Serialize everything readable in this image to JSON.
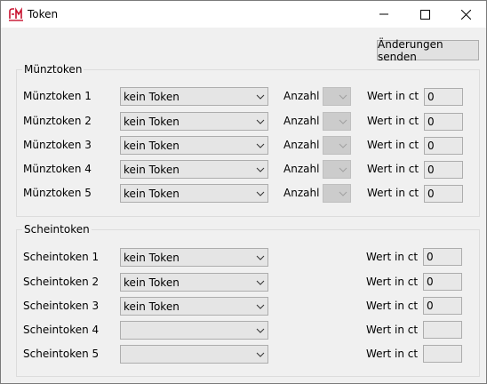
{
  "window": {
    "title": "Token",
    "icon": "app-logo-icon",
    "controls": [
      "minimize-icon",
      "maximize-icon",
      "close-icon"
    ]
  },
  "send_button": {
    "label": "Änderungen senden"
  },
  "coin_group": {
    "title": "Münztoken",
    "count_label": "Anzahl",
    "value_label": "Wert in ct",
    "rows": [
      {
        "label": "Münztoken 1",
        "token": "kein Token",
        "value": "0"
      },
      {
        "label": "Münztoken 2",
        "token": "kein Token",
        "value": "0"
      },
      {
        "label": "Münztoken 3",
        "token": "kein Token",
        "value": "0"
      },
      {
        "label": "Münztoken 4",
        "token": "kein Token",
        "value": "0"
      },
      {
        "label": "Münztoken 5",
        "token": "kein Token",
        "value": "0"
      }
    ]
  },
  "note_group": {
    "title": "Scheintoken",
    "value_label": "Wert in ct",
    "rows": [
      {
        "label": "Scheintoken 1",
        "token": "kein Token",
        "value": "0"
      },
      {
        "label": "Scheintoken 2",
        "token": "kein Token",
        "value": "0"
      },
      {
        "label": "Scheintoken 3",
        "token": "kein Token",
        "value": "0"
      },
      {
        "label": "Scheintoken 4",
        "token": "",
        "value": ""
      },
      {
        "label": "Scheintoken 5",
        "token": "",
        "value": ""
      }
    ]
  },
  "colors": {
    "window_bg": "#f0f0f0",
    "logo_red": "#c8102e"
  }
}
